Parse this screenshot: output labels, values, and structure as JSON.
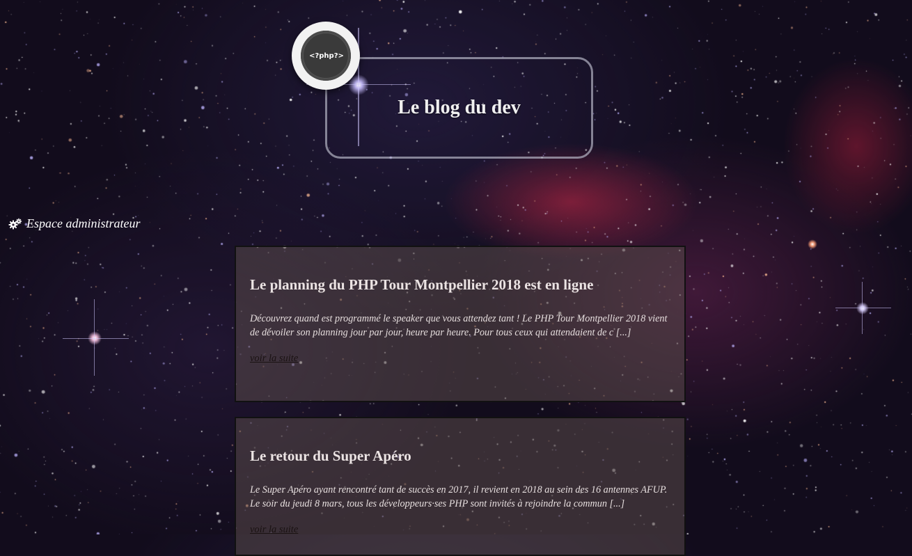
{
  "header": {
    "logo_text": "<?php?>",
    "title": "Le blog du dev"
  },
  "nav": {
    "admin_label": "Espace administrateur",
    "admin_icon": "gears-icon"
  },
  "posts": [
    {
      "title": "Le planning du PHP Tour Montpellier 2018 est en ligne",
      "excerpt": "Découvrez quand est programmé le speaker que vous attendez tant ! Le PHP Tour Montpellier 2018 vient de dévoiler son planning jour par jour, heure par heure. Pour tous ceux qui attendaient de c [...]",
      "more_label": "voir la suite"
    },
    {
      "title": "Le retour du Super Apéro",
      "excerpt": "Le Super Apéro ayant rencontré tant de succès en 2017, il revient en 2018 au sein des 16 antennes AFUP. Le soir du jeudi 8 mars, tous les développeurs·ses PHP sont invités à rejoindre la commun [...]",
      "more_label": "voir la suite"
    }
  ],
  "colors": {
    "background": "#120c1c",
    "post_background": "#5a4b4b",
    "title_border": "#b4b4c3",
    "text": "#e6dede"
  }
}
